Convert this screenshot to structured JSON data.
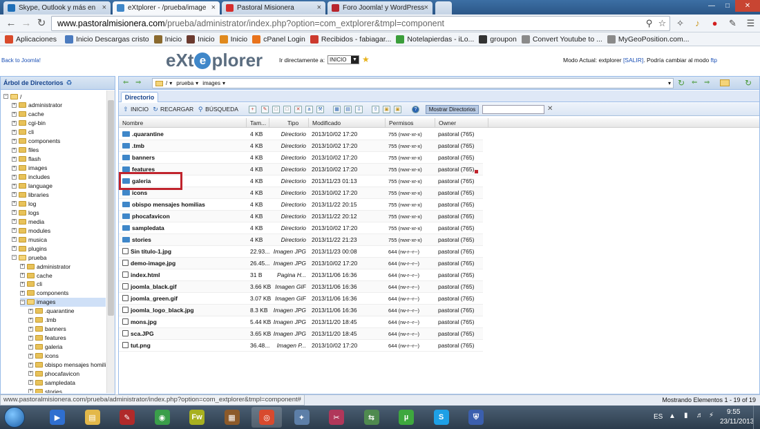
{
  "browser": {
    "tabs": [
      {
        "label": "Skype, Outlook y más en ",
        "icon": "skype-tab-icon",
        "color": "#1e6fb8",
        "active": false
      },
      {
        "label": "eXtplorer - /prueba/image",
        "icon": "extplorer-tab-icon",
        "color": "#3f87c9",
        "active": true
      },
      {
        "label": "Pastoral Misionera",
        "icon": "joomla-tab-icon",
        "color": "#d62d2d",
        "active": false
      },
      {
        "label": "Foro Joomla! y WordPress",
        "icon": "foro-tab-icon",
        "color": "#b8252d",
        "active": false
      }
    ],
    "url": {
      "host": "www.pastoralmisionera.com",
      "path": "/prueba/administrator/index.php?option=com_extplorer&tmpl=component"
    },
    "bookmarks": [
      {
        "label": "Aplicaciones",
        "icon": "apps-grid-icon",
        "color": "#d94a2b"
      },
      {
        "label": "Inicio Descargas cristo",
        "icon": "page-icon",
        "color": "#4b7bbf"
      },
      {
        "label": "Inicio",
        "icon": "site-icon",
        "color": "#8a6a2f"
      },
      {
        "label": "Inicio",
        "icon": "site-icon",
        "color": "#6b3a2f"
      },
      {
        "label": "Inicio",
        "icon": "joomla-icon",
        "color": "#e08a1e"
      },
      {
        "label": "cPanel Login",
        "icon": "cpanel-icon",
        "color": "#e8731c"
      },
      {
        "label": "Recibidos - fabiagar...",
        "icon": "gmail-icon",
        "color": "#cc3a2e"
      },
      {
        "label": "Notelapierdas - iLo...",
        "icon": "ilo-icon",
        "color": "#3b9e3b"
      },
      {
        "label": "groupon",
        "icon": "groupon-icon",
        "color": "#333333"
      },
      {
        "label": "Convert Youtube to ...",
        "icon": "page-icon",
        "color": "#8a8a8a"
      },
      {
        "label": "MyGeoPosition.com...",
        "icon": "page-icon",
        "color": "#8a8a8a"
      }
    ],
    "status_url": "www.pastoralmisionera.com/prueba/administrator/index.php?option=com_extplorer&tmpl=component#"
  },
  "app": {
    "back_link": "Back to Joomla!",
    "logo_left": "eXt",
    "logo_o": "e",
    "logo_right": "plorer",
    "goto_label": "Ir directamente a:",
    "goto_value": "INICIO",
    "mode_prefix": "Modo Actual: extplorer ",
    "mode_exit": "[SALIR]",
    "mode_mid": ". Podría cambiar al modo ",
    "mode_ftp": "ftp",
    "tree_title": "Árbol de Directorios",
    "path_parts": [
      "/",
      "prueba",
      "images"
    ],
    "dir_tab": "Directorio",
    "actions": {
      "home": "INICIO",
      "reload": "RECARGAR",
      "search": "BÚSQUEDA",
      "show_dirs": "Mostrar Directorios"
    },
    "columns": [
      "Nombre",
      "Tam...",
      "Tipo",
      "Modificado",
      "Permisos",
      "Owner"
    ],
    "status_right": "Mostrando Elementos 1 - 19 of 19"
  },
  "tree": [
    {
      "label": "/",
      "depth": 0,
      "open": true
    },
    {
      "label": "administrator",
      "depth": 1
    },
    {
      "label": "cache",
      "depth": 1
    },
    {
      "label": "cgi-bin",
      "depth": 1
    },
    {
      "label": "cli",
      "depth": 1
    },
    {
      "label": "components",
      "depth": 1
    },
    {
      "label": "files",
      "depth": 1
    },
    {
      "label": "flash",
      "depth": 1
    },
    {
      "label": "images",
      "depth": 1
    },
    {
      "label": "includes",
      "depth": 1
    },
    {
      "label": "language",
      "depth": 1
    },
    {
      "label": "libraries",
      "depth": 1
    },
    {
      "label": "log",
      "depth": 1
    },
    {
      "label": "logs",
      "depth": 1
    },
    {
      "label": "media",
      "depth": 1
    },
    {
      "label": "modules",
      "depth": 1
    },
    {
      "label": "musica",
      "depth": 1
    },
    {
      "label": "plugins",
      "depth": 1
    },
    {
      "label": "prueba",
      "depth": 1,
      "open": true
    },
    {
      "label": "administrator",
      "depth": 2
    },
    {
      "label": "cache",
      "depth": 2
    },
    {
      "label": "cli",
      "depth": 2
    },
    {
      "label": "components",
      "depth": 2
    },
    {
      "label": "images",
      "depth": 2,
      "open": true,
      "selected": true
    },
    {
      "label": ".quarantine",
      "depth": 3
    },
    {
      "label": ".tmb",
      "depth": 3
    },
    {
      "label": "banners",
      "depth": 3
    },
    {
      "label": "features",
      "depth": 3
    },
    {
      "label": "galeria",
      "depth": 3
    },
    {
      "label": "icons",
      "depth": 3
    },
    {
      "label": "obispo mensajes homilia",
      "depth": 3
    },
    {
      "label": "phocafavicon",
      "depth": 3
    },
    {
      "label": "sampledata",
      "depth": 3
    },
    {
      "label": "stories",
      "depth": 3
    }
  ],
  "files": [
    {
      "name": ".quarantine",
      "size": "4 KB",
      "type": "Directorio",
      "modified": "2013/10/02 17:20",
      "perms": "755 (rwxr-xr-x)",
      "owner": "pastoral (765)",
      "dir": true
    },
    {
      "name": ".tmb",
      "size": "4 KB",
      "type": "Directorio",
      "modified": "2013/10/02 17:20",
      "perms": "755 (rwxr-xr-x)",
      "owner": "pastoral (765)",
      "dir": true
    },
    {
      "name": "banners",
      "size": "4 KB",
      "type": "Directorio",
      "modified": "2013/10/02 17:20",
      "perms": "755 (rwxr-xr-x)",
      "owner": "pastoral (765)",
      "dir": true
    },
    {
      "name": "features",
      "size": "4 KB",
      "type": "Directorio",
      "modified": "2013/10/02 17:20",
      "perms": "755 (rwxr-xr-x)",
      "owner": "pastoral (765)",
      "dir": true
    },
    {
      "name": "galeria",
      "size": "4 KB",
      "type": "Directorio",
      "modified": "2013/11/23 01:13",
      "perms": "755 (rwxr-xr-x)",
      "owner": "pastoral (765)",
      "dir": true
    },
    {
      "name": "icons",
      "size": "4 KB",
      "type": "Directorio",
      "modified": "2013/10/02 17:20",
      "perms": "755 (rwxr-xr-x)",
      "owner": "pastoral (765)",
      "dir": true
    },
    {
      "name": "obispo mensajes homilias",
      "size": "4 KB",
      "type": "Directorio",
      "modified": "2013/11/22 20:15",
      "perms": "755 (rwxr-xr-x)",
      "owner": "pastoral (765)",
      "dir": true
    },
    {
      "name": "phocafavicon",
      "size": "4 KB",
      "type": "Directorio",
      "modified": "2013/11/22 20:12",
      "perms": "755 (rwxr-xr-x)",
      "owner": "pastoral (765)",
      "dir": true
    },
    {
      "name": "sampledata",
      "size": "4 KB",
      "type": "Directorio",
      "modified": "2013/10/02 17:20",
      "perms": "755 (rwxr-xr-x)",
      "owner": "pastoral (765)",
      "dir": true
    },
    {
      "name": "stories",
      "size": "4 KB",
      "type": "Directorio",
      "modified": "2013/11/22 21:23",
      "perms": "755 (rwxr-xr-x)",
      "owner": "pastoral (765)",
      "dir": true
    },
    {
      "name": "Sin título-1.jpg",
      "size": "22.93...",
      "type": "Imagen JPG",
      "modified": "2013/11/23 00:08",
      "perms": "644 (rw-r--r--)",
      "owner": "pastoral (765)",
      "dir": false
    },
    {
      "name": "demo-image.jpg",
      "size": "26.45...",
      "type": "Imagen JPG",
      "modified": "2013/10/02 17:20",
      "perms": "644 (rw-r--r--)",
      "owner": "pastoral (765)",
      "dir": false
    },
    {
      "name": "index.html",
      "size": "31 B",
      "type": "Pagina H...",
      "modified": "2013/11/06 16:36",
      "perms": "644 (rw-r--r--)",
      "owner": "pastoral (765)",
      "dir": false
    },
    {
      "name": "joomla_black.gif",
      "size": "3.66 KB",
      "type": "Imagen GIF",
      "modified": "2013/11/06 16:36",
      "perms": "644 (rw-r--r--)",
      "owner": "pastoral (765)",
      "dir": false
    },
    {
      "name": "joomla_green.gif",
      "size": "3.07 KB",
      "type": "Imagen GIF",
      "modified": "2013/11/06 16:36",
      "perms": "644 (rw-r--r--)",
      "owner": "pastoral (765)",
      "dir": false
    },
    {
      "name": "joomla_logo_black.jpg",
      "size": "8.3 KB",
      "type": "Imagen JPG",
      "modified": "2013/11/06 16:36",
      "perms": "644 (rw-r--r--)",
      "owner": "pastoral (765)",
      "dir": false
    },
    {
      "name": "mons.jpg",
      "size": "5.44 KB",
      "type": "Imagen JPG",
      "modified": "2013/11/20 18:45",
      "perms": "644 (rw-r--r--)",
      "owner": "pastoral (765)",
      "dir": false
    },
    {
      "name": "sca.JPG",
      "size": "3.65 KB",
      "type": "Imagen JPG",
      "modified": "2013/11/20 18:45",
      "perms": "644 (rw-r--r--)",
      "owner": "pastoral (765)",
      "dir": false
    },
    {
      "name": "tut.png",
      "size": "36.48...",
      "type": "Imagen P...",
      "modified": "2013/10/02 17:20",
      "perms": "644 (rw-r--r--)",
      "owner": "pastoral (765)",
      "dir": false
    }
  ],
  "taskbar": {
    "apps": [
      {
        "name": "media-player-icon",
        "color": "#2f6fd0",
        "glyph": "▶"
      },
      {
        "name": "file-explorer-icon",
        "color": "#e3b84a",
        "glyph": "▤"
      },
      {
        "name": "pen-tool-icon",
        "color": "#b02a2a",
        "glyph": "✎"
      },
      {
        "name": "globe-app-icon",
        "color": "#3a9e4a",
        "glyph": "◉"
      },
      {
        "name": "fireworks-icon",
        "color": "#a7b020",
        "glyph": "Fw"
      },
      {
        "name": "archive-icon",
        "color": "#8c5a2a",
        "glyph": "▦"
      },
      {
        "name": "chrome-icon",
        "color": "#d84a2e",
        "glyph": "◎"
      },
      {
        "name": "network-app-icon",
        "color": "#5d7fa8",
        "glyph": "✦"
      },
      {
        "name": "tool-app-icon",
        "color": "#b0375a",
        "glyph": "✂"
      },
      {
        "name": "remote-app-icon",
        "color": "#4f8a4f",
        "glyph": "⇆"
      },
      {
        "name": "utorrent-icon",
        "color": "#3ea83e",
        "glyph": "µ"
      },
      {
        "name": "skype-icon",
        "color": "#1ea0e6",
        "glyph": "S"
      },
      {
        "name": "security-shield-icon",
        "color": "#3b5fae",
        "glyph": "⛨"
      }
    ],
    "lang": "ES",
    "time": "9:55",
    "date": "23/11/2013"
  }
}
